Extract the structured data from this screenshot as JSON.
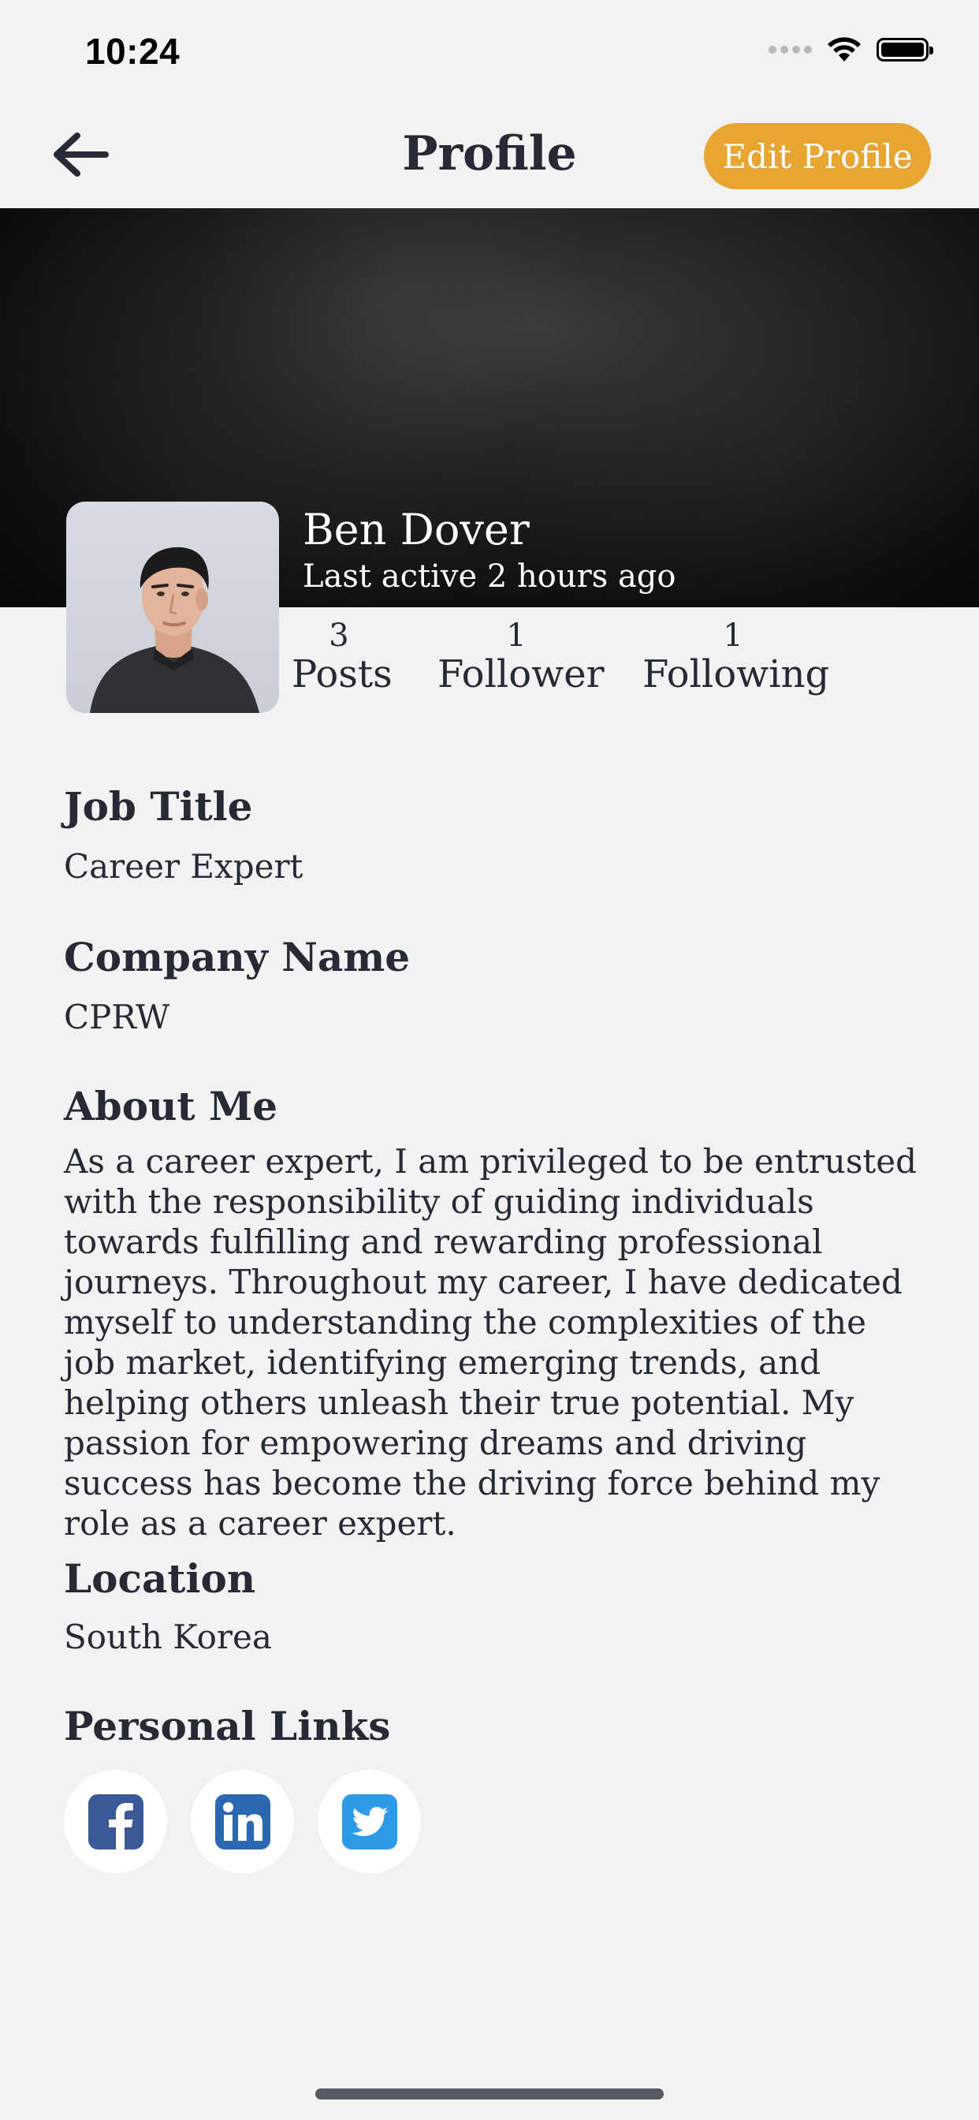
{
  "status_bar": {
    "time": "10:24"
  },
  "header": {
    "title": "Profile",
    "edit_label": "Edit Profile",
    "accent_color": "#e9a531"
  },
  "profile": {
    "name": "Ben Dover",
    "last_active": "Last active 2 hours ago"
  },
  "stats": [
    {
      "value": "3",
      "label": "Posts"
    },
    {
      "value": "1",
      "label": "Follower"
    },
    {
      "value": "1",
      "label": "Following"
    }
  ],
  "sections": {
    "job_title": {
      "label": "Job Title",
      "value": "Career Expert"
    },
    "company": {
      "label": "Company Name",
      "value": "CPRW"
    },
    "about": {
      "label": "About Me",
      "value": "As a career expert, I am privileged to be entrusted with the responsibility of guiding individuals towards fulfilling and rewarding professional journeys. Throughout my career, I have dedicated myself to understanding the complexities of the job market, identifying emerging trends, and helping others unleash their true potential. My passion for empowering dreams and driving success has become the driving force behind my role as a career expert."
    },
    "location": {
      "label": "Location",
      "value": "South Korea"
    },
    "links": {
      "label": "Personal Links",
      "items": [
        {
          "icon": "facebook-icon",
          "color": "#3b5998"
        },
        {
          "icon": "linkedin-icon",
          "color": "#2c67b2"
        },
        {
          "icon": "twitter-icon",
          "color": "#2f9be8"
        }
      ]
    }
  }
}
